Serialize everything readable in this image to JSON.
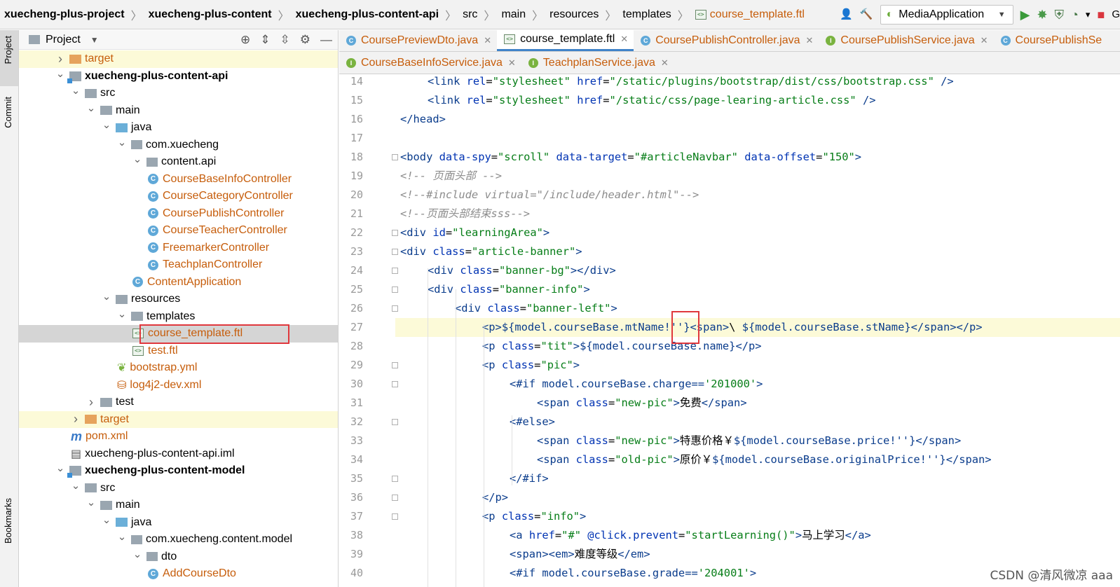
{
  "breadcrumb": [
    "xuecheng-plus-project",
    "xuecheng-plus-content",
    "xuecheng-plus-content-api",
    "src",
    "main",
    "resources",
    "templates",
    "course_template.ftl"
  ],
  "run_config": "MediaApplication",
  "left_strip": {
    "project": "Project",
    "commit": "Commit",
    "bookmarks": "Bookmarks"
  },
  "project_panel": {
    "title": "Project"
  },
  "tree": [
    {
      "label": "target",
      "depth": 3,
      "icon": "folder-orange",
      "arrow": "right",
      "style": "orange",
      "hl": true
    },
    {
      "label": "xuecheng-plus-content-api",
      "depth": 3,
      "icon": "module",
      "arrow": "down",
      "style": "bold"
    },
    {
      "label": "src",
      "depth": 4,
      "icon": "folder-gray",
      "arrow": "down"
    },
    {
      "label": "main",
      "depth": 5,
      "icon": "folder-gray",
      "arrow": "down"
    },
    {
      "label": "java",
      "depth": 6,
      "icon": "folder-blue",
      "arrow": "down"
    },
    {
      "label": "com.xuecheng",
      "depth": 7,
      "icon": "package",
      "arrow": "down"
    },
    {
      "label": "content.api",
      "depth": 8,
      "icon": "package",
      "arrow": "down"
    },
    {
      "label": "CourseBaseInfoController",
      "depth": 9,
      "icon": "class",
      "style": "orange"
    },
    {
      "label": "CourseCategoryController",
      "depth": 9,
      "icon": "class",
      "style": "orange"
    },
    {
      "label": "CoursePublishController",
      "depth": 9,
      "icon": "class",
      "style": "orange"
    },
    {
      "label": "CourseTeacherController",
      "depth": 9,
      "icon": "class",
      "style": "orange"
    },
    {
      "label": "FreemarkerController",
      "depth": 9,
      "icon": "class",
      "style": "orange"
    },
    {
      "label": "TeachplanController",
      "depth": 9,
      "icon": "class",
      "style": "orange"
    },
    {
      "label": "ContentApplication",
      "depth": 8,
      "icon": "class",
      "style": "orange"
    },
    {
      "label": "resources",
      "depth": 6,
      "icon": "folder-gray",
      "arrow": "down"
    },
    {
      "label": "templates",
      "depth": 7,
      "icon": "folder-gray",
      "arrow": "down"
    },
    {
      "label": "course_template.ftl",
      "depth": 8,
      "icon": "ftl",
      "style": "orange",
      "sel": true
    },
    {
      "label": "test.ftl",
      "depth": 8,
      "icon": "ftl",
      "style": "orange"
    },
    {
      "label": "bootstrap.yml",
      "depth": 7,
      "icon": "yml",
      "style": "orange"
    },
    {
      "label": "log4j2-dev.xml",
      "depth": 7,
      "icon": "xml",
      "style": "orange"
    },
    {
      "label": "test",
      "depth": 5,
      "icon": "folder-gray",
      "arrow": "right"
    },
    {
      "label": "target",
      "depth": 4,
      "icon": "folder-orange",
      "arrow": "right",
      "style": "orange",
      "hl": true
    },
    {
      "label": "pom.xml",
      "depth": 4,
      "icon": "maven",
      "style": "orange"
    },
    {
      "label": "xuecheng-plus-content-api.iml",
      "depth": 4,
      "icon": "iml"
    },
    {
      "label": "xuecheng-plus-content-model",
      "depth": 3,
      "icon": "module",
      "arrow": "down",
      "style": "bold"
    },
    {
      "label": "src",
      "depth": 4,
      "icon": "folder-gray",
      "arrow": "down"
    },
    {
      "label": "main",
      "depth": 5,
      "icon": "folder-gray",
      "arrow": "down"
    },
    {
      "label": "java",
      "depth": 6,
      "icon": "folder-blue",
      "arrow": "down"
    },
    {
      "label": "com.xuecheng.content.model",
      "depth": 7,
      "icon": "package",
      "arrow": "down"
    },
    {
      "label": "dto",
      "depth": 8,
      "icon": "package",
      "arrow": "down"
    },
    {
      "label": "AddCourseDto",
      "depth": 9,
      "icon": "class",
      "style": "orange"
    }
  ],
  "tabs_row1": [
    {
      "label": "CoursePreviewDto.java",
      "icon": "class"
    },
    {
      "label": "course_template.ftl",
      "icon": "ftl",
      "active": true
    },
    {
      "label": "CoursePublishController.java",
      "icon": "class"
    },
    {
      "label": "CoursePublishService.java",
      "icon": "interface"
    },
    {
      "label": "CoursePublishSe",
      "icon": "class"
    }
  ],
  "tabs_row2": [
    {
      "label": "CourseBaseInfoService.java",
      "icon": "interface"
    },
    {
      "label": "TeachplanService.java",
      "icon": "interface"
    }
  ],
  "code_lines": [
    {
      "n": "14",
      "indent": 1,
      "parts": [
        [
          "tg",
          "<link "
        ],
        [
          "at",
          "rel"
        ],
        [
          "pu",
          "="
        ],
        [
          "st",
          "\"stylesheet\""
        ],
        [
          "pu",
          " "
        ],
        [
          "at",
          "href"
        ],
        [
          "pu",
          "="
        ],
        [
          "st",
          "\"/static/plugins/bootstrap/dist/css/bootstrap.css\""
        ],
        [
          "pu",
          " "
        ],
        [
          "tg",
          "/>"
        ]
      ]
    },
    {
      "n": "15",
      "indent": 1,
      "parts": [
        [
          "tg",
          "<link "
        ],
        [
          "at",
          "rel"
        ],
        [
          "pu",
          "="
        ],
        [
          "st",
          "\"stylesheet\""
        ],
        [
          "pu",
          " "
        ],
        [
          "at",
          "href"
        ],
        [
          "pu",
          "="
        ],
        [
          "st",
          "\"/static/css/page-learing-article.css\""
        ],
        [
          "pu",
          " "
        ],
        [
          "tg",
          "/>"
        ]
      ]
    },
    {
      "n": "16",
      "indent": 0,
      "parts": [
        [
          "tg",
          "</head>"
        ]
      ]
    },
    {
      "n": "17",
      "indent": 0,
      "parts": []
    },
    {
      "n": "18",
      "indent": 0,
      "parts": [
        [
          "tg",
          "<body "
        ],
        [
          "at",
          "data-spy"
        ],
        [
          "pu",
          "="
        ],
        [
          "st",
          "\"scroll\""
        ],
        [
          "pu",
          " "
        ],
        [
          "at",
          "data-target"
        ],
        [
          "pu",
          "="
        ],
        [
          "st",
          "\"#articleNavbar\""
        ],
        [
          "pu",
          " "
        ],
        [
          "at",
          "data-offset"
        ],
        [
          "pu",
          "="
        ],
        [
          "st",
          "\"150\""
        ],
        [
          "tg",
          ">"
        ]
      ]
    },
    {
      "n": "19",
      "indent": 0,
      "parts": [
        [
          "cm",
          "<!-- 页面头部 -->"
        ]
      ]
    },
    {
      "n": "20",
      "indent": 0,
      "parts": [
        [
          "cm",
          "<!--#include virtual=\"/include/header.html\"-->"
        ]
      ]
    },
    {
      "n": "21",
      "indent": 0,
      "parts": [
        [
          "cm",
          "<!--页面头部结束sss-->"
        ]
      ]
    },
    {
      "n": "22",
      "indent": 0,
      "parts": [
        [
          "tg",
          "<div "
        ],
        [
          "at",
          "id"
        ],
        [
          "pu",
          "="
        ],
        [
          "st",
          "\"learningArea\""
        ],
        [
          "tg",
          ">"
        ]
      ]
    },
    {
      "n": "23",
      "indent": 0,
      "parts": [
        [
          "tg",
          "<div "
        ],
        [
          "at",
          "class"
        ],
        [
          "pu",
          "="
        ],
        [
          "st",
          "\"article-banner\""
        ],
        [
          "tg",
          ">"
        ]
      ]
    },
    {
      "n": "24",
      "indent": 1,
      "parts": [
        [
          "tg",
          "<div "
        ],
        [
          "at",
          "class"
        ],
        [
          "pu",
          "="
        ],
        [
          "st",
          "\"banner-bg\""
        ],
        [
          "tg",
          "></div>"
        ]
      ]
    },
    {
      "n": "25",
      "indent": 1,
      "parts": [
        [
          "tg",
          "<div "
        ],
        [
          "at",
          "class"
        ],
        [
          "pu",
          "="
        ],
        [
          "st",
          "\"banner-info\""
        ],
        [
          "tg",
          ">"
        ]
      ]
    },
    {
      "n": "26",
      "indent": 2,
      "parts": [
        [
          "tg",
          "<div "
        ],
        [
          "at",
          "class"
        ],
        [
          "pu",
          "="
        ],
        [
          "st",
          "\"banner-left\""
        ],
        [
          "tg",
          ">"
        ]
      ]
    },
    {
      "n": "27",
      "indent": 3,
      "cur": true,
      "parts": [
        [
          "tg",
          "<p>"
        ],
        [
          "ex",
          "${model.courseBase.mtName!''}"
        ],
        [
          "tg",
          "<span>"
        ],
        [
          "pu",
          "\\ "
        ],
        [
          "ex",
          "${model.courseBase.stName}"
        ],
        [
          "tg",
          "</span></p>"
        ]
      ]
    },
    {
      "n": "28",
      "indent": 3,
      "parts": [
        [
          "tg",
          "<p "
        ],
        [
          "at",
          "class"
        ],
        [
          "pu",
          "="
        ],
        [
          "st",
          "\"tit\""
        ],
        [
          "tg",
          ">"
        ],
        [
          "ex",
          "${model.courseBase.name}"
        ],
        [
          "tg",
          "</p>"
        ]
      ]
    },
    {
      "n": "29",
      "indent": 3,
      "parts": [
        [
          "tg",
          "<p "
        ],
        [
          "at",
          "class"
        ],
        [
          "pu",
          "="
        ],
        [
          "st",
          "\"pic\""
        ],
        [
          "tg",
          ">"
        ]
      ]
    },
    {
      "n": "30",
      "indent": 4,
      "parts": [
        [
          "fl",
          "<#if "
        ],
        [
          "ex",
          "model.courseBase.charge=="
        ],
        [
          "st",
          "'201000'"
        ],
        [
          "fl",
          ">"
        ]
      ]
    },
    {
      "n": "31",
      "indent": 5,
      "parts": [
        [
          "tg",
          "<span "
        ],
        [
          "at",
          "class"
        ],
        [
          "pu",
          "="
        ],
        [
          "st",
          "\"new-pic\""
        ],
        [
          "tg",
          ">"
        ],
        [
          "pu",
          "免费"
        ],
        [
          "tg",
          "</span>"
        ]
      ]
    },
    {
      "n": "32",
      "indent": 4,
      "parts": [
        [
          "fl",
          "<#else>"
        ]
      ]
    },
    {
      "n": "33",
      "indent": 5,
      "parts": [
        [
          "tg",
          "<span "
        ],
        [
          "at",
          "class"
        ],
        [
          "pu",
          "="
        ],
        [
          "st",
          "\"new-pic\""
        ],
        [
          "tg",
          ">"
        ],
        [
          "pu",
          "特惠价格￥"
        ],
        [
          "ex",
          "${model.courseBase.price!''}"
        ],
        [
          "tg",
          "</span>"
        ]
      ]
    },
    {
      "n": "34",
      "indent": 5,
      "parts": [
        [
          "tg",
          "<span "
        ],
        [
          "at",
          "class"
        ],
        [
          "pu",
          "="
        ],
        [
          "st",
          "\"old-pic\""
        ],
        [
          "tg",
          ">"
        ],
        [
          "pu",
          "原价￥"
        ],
        [
          "ex",
          "${model.courseBase.originalPrice!''}"
        ],
        [
          "tg",
          "</span>"
        ]
      ]
    },
    {
      "n": "35",
      "indent": 4,
      "parts": [
        [
          "fl",
          "</#if>"
        ]
      ]
    },
    {
      "n": "36",
      "indent": 3,
      "parts": [
        [
          "tg",
          "</p>"
        ]
      ]
    },
    {
      "n": "37",
      "indent": 3,
      "parts": [
        [
          "tg",
          "<p "
        ],
        [
          "at",
          "class"
        ],
        [
          "pu",
          "="
        ],
        [
          "st",
          "\"info\""
        ],
        [
          "tg",
          ">"
        ]
      ]
    },
    {
      "n": "38",
      "indent": 4,
      "parts": [
        [
          "tg",
          "<a "
        ],
        [
          "at",
          "href"
        ],
        [
          "pu",
          "="
        ],
        [
          "st",
          "\"#\""
        ],
        [
          "pu",
          " "
        ],
        [
          "at",
          "@click.prevent"
        ],
        [
          "pu",
          "="
        ],
        [
          "st",
          "\"startLearning()\""
        ],
        [
          "tg",
          ">"
        ],
        [
          "pu",
          "马上学习"
        ],
        [
          "tg",
          "</a>"
        ]
      ]
    },
    {
      "n": "39",
      "indent": 4,
      "parts": [
        [
          "tg",
          "<span><em>"
        ],
        [
          "pu",
          "难度等级"
        ],
        [
          "tg",
          "</em>"
        ]
      ]
    },
    {
      "n": "40",
      "indent": 4,
      "parts": [
        [
          "fl",
          "<#if "
        ],
        [
          "ex",
          "model.courseBase.grade=="
        ],
        [
          "st",
          "'204001'"
        ],
        [
          "fl",
          ">"
        ]
      ]
    }
  ],
  "watermark": "CSDN @清风微凉 aaa"
}
